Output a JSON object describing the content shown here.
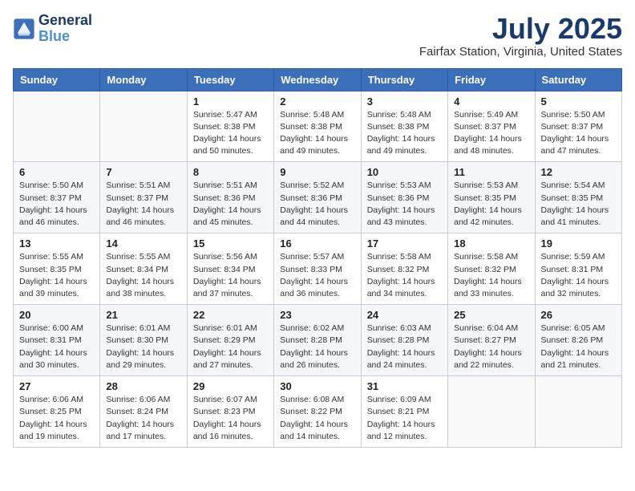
{
  "header": {
    "logo_line1": "General",
    "logo_line2": "Blue",
    "month": "July 2025",
    "location": "Fairfax Station, Virginia, United States"
  },
  "days_of_week": [
    "Sunday",
    "Monday",
    "Tuesday",
    "Wednesday",
    "Thursday",
    "Friday",
    "Saturday"
  ],
  "weeks": [
    [
      {
        "day": "",
        "sunrise": "",
        "sunset": "",
        "daylight": ""
      },
      {
        "day": "",
        "sunrise": "",
        "sunset": "",
        "daylight": ""
      },
      {
        "day": "1",
        "sunrise": "Sunrise: 5:47 AM",
        "sunset": "Sunset: 8:38 PM",
        "daylight": "Daylight: 14 hours and 50 minutes."
      },
      {
        "day": "2",
        "sunrise": "Sunrise: 5:48 AM",
        "sunset": "Sunset: 8:38 PM",
        "daylight": "Daylight: 14 hours and 49 minutes."
      },
      {
        "day": "3",
        "sunrise": "Sunrise: 5:48 AM",
        "sunset": "Sunset: 8:38 PM",
        "daylight": "Daylight: 14 hours and 49 minutes."
      },
      {
        "day": "4",
        "sunrise": "Sunrise: 5:49 AM",
        "sunset": "Sunset: 8:37 PM",
        "daylight": "Daylight: 14 hours and 48 minutes."
      },
      {
        "day": "5",
        "sunrise": "Sunrise: 5:50 AM",
        "sunset": "Sunset: 8:37 PM",
        "daylight": "Daylight: 14 hours and 47 minutes."
      }
    ],
    [
      {
        "day": "6",
        "sunrise": "Sunrise: 5:50 AM",
        "sunset": "Sunset: 8:37 PM",
        "daylight": "Daylight: 14 hours and 46 minutes."
      },
      {
        "day": "7",
        "sunrise": "Sunrise: 5:51 AM",
        "sunset": "Sunset: 8:37 PM",
        "daylight": "Daylight: 14 hours and 46 minutes."
      },
      {
        "day": "8",
        "sunrise": "Sunrise: 5:51 AM",
        "sunset": "Sunset: 8:36 PM",
        "daylight": "Daylight: 14 hours and 45 minutes."
      },
      {
        "day": "9",
        "sunrise": "Sunrise: 5:52 AM",
        "sunset": "Sunset: 8:36 PM",
        "daylight": "Daylight: 14 hours and 44 minutes."
      },
      {
        "day": "10",
        "sunrise": "Sunrise: 5:53 AM",
        "sunset": "Sunset: 8:36 PM",
        "daylight": "Daylight: 14 hours and 43 minutes."
      },
      {
        "day": "11",
        "sunrise": "Sunrise: 5:53 AM",
        "sunset": "Sunset: 8:35 PM",
        "daylight": "Daylight: 14 hours and 42 minutes."
      },
      {
        "day": "12",
        "sunrise": "Sunrise: 5:54 AM",
        "sunset": "Sunset: 8:35 PM",
        "daylight": "Daylight: 14 hours and 41 minutes."
      }
    ],
    [
      {
        "day": "13",
        "sunrise": "Sunrise: 5:55 AM",
        "sunset": "Sunset: 8:35 PM",
        "daylight": "Daylight: 14 hours and 39 minutes."
      },
      {
        "day": "14",
        "sunrise": "Sunrise: 5:55 AM",
        "sunset": "Sunset: 8:34 PM",
        "daylight": "Daylight: 14 hours and 38 minutes."
      },
      {
        "day": "15",
        "sunrise": "Sunrise: 5:56 AM",
        "sunset": "Sunset: 8:34 PM",
        "daylight": "Daylight: 14 hours and 37 minutes."
      },
      {
        "day": "16",
        "sunrise": "Sunrise: 5:57 AM",
        "sunset": "Sunset: 8:33 PM",
        "daylight": "Daylight: 14 hours and 36 minutes."
      },
      {
        "day": "17",
        "sunrise": "Sunrise: 5:58 AM",
        "sunset": "Sunset: 8:32 PM",
        "daylight": "Daylight: 14 hours and 34 minutes."
      },
      {
        "day": "18",
        "sunrise": "Sunrise: 5:58 AM",
        "sunset": "Sunset: 8:32 PM",
        "daylight": "Daylight: 14 hours and 33 minutes."
      },
      {
        "day": "19",
        "sunrise": "Sunrise: 5:59 AM",
        "sunset": "Sunset: 8:31 PM",
        "daylight": "Daylight: 14 hours and 32 minutes."
      }
    ],
    [
      {
        "day": "20",
        "sunrise": "Sunrise: 6:00 AM",
        "sunset": "Sunset: 8:31 PM",
        "daylight": "Daylight: 14 hours and 30 minutes."
      },
      {
        "day": "21",
        "sunrise": "Sunrise: 6:01 AM",
        "sunset": "Sunset: 8:30 PM",
        "daylight": "Daylight: 14 hours and 29 minutes."
      },
      {
        "day": "22",
        "sunrise": "Sunrise: 6:01 AM",
        "sunset": "Sunset: 8:29 PM",
        "daylight": "Daylight: 14 hours and 27 minutes."
      },
      {
        "day": "23",
        "sunrise": "Sunrise: 6:02 AM",
        "sunset": "Sunset: 8:28 PM",
        "daylight": "Daylight: 14 hours and 26 minutes."
      },
      {
        "day": "24",
        "sunrise": "Sunrise: 6:03 AM",
        "sunset": "Sunset: 8:28 PM",
        "daylight": "Daylight: 14 hours and 24 minutes."
      },
      {
        "day": "25",
        "sunrise": "Sunrise: 6:04 AM",
        "sunset": "Sunset: 8:27 PM",
        "daylight": "Daylight: 14 hours and 22 minutes."
      },
      {
        "day": "26",
        "sunrise": "Sunrise: 6:05 AM",
        "sunset": "Sunset: 8:26 PM",
        "daylight": "Daylight: 14 hours and 21 minutes."
      }
    ],
    [
      {
        "day": "27",
        "sunrise": "Sunrise: 6:06 AM",
        "sunset": "Sunset: 8:25 PM",
        "daylight": "Daylight: 14 hours and 19 minutes."
      },
      {
        "day": "28",
        "sunrise": "Sunrise: 6:06 AM",
        "sunset": "Sunset: 8:24 PM",
        "daylight": "Daylight: 14 hours and 17 minutes."
      },
      {
        "day": "29",
        "sunrise": "Sunrise: 6:07 AM",
        "sunset": "Sunset: 8:23 PM",
        "daylight": "Daylight: 14 hours and 16 minutes."
      },
      {
        "day": "30",
        "sunrise": "Sunrise: 6:08 AM",
        "sunset": "Sunset: 8:22 PM",
        "daylight": "Daylight: 14 hours and 14 minutes."
      },
      {
        "day": "31",
        "sunrise": "Sunrise: 6:09 AM",
        "sunset": "Sunset: 8:21 PM",
        "daylight": "Daylight: 14 hours and 12 minutes."
      },
      {
        "day": "",
        "sunrise": "",
        "sunset": "",
        "daylight": ""
      },
      {
        "day": "",
        "sunrise": "",
        "sunset": "",
        "daylight": ""
      }
    ]
  ]
}
